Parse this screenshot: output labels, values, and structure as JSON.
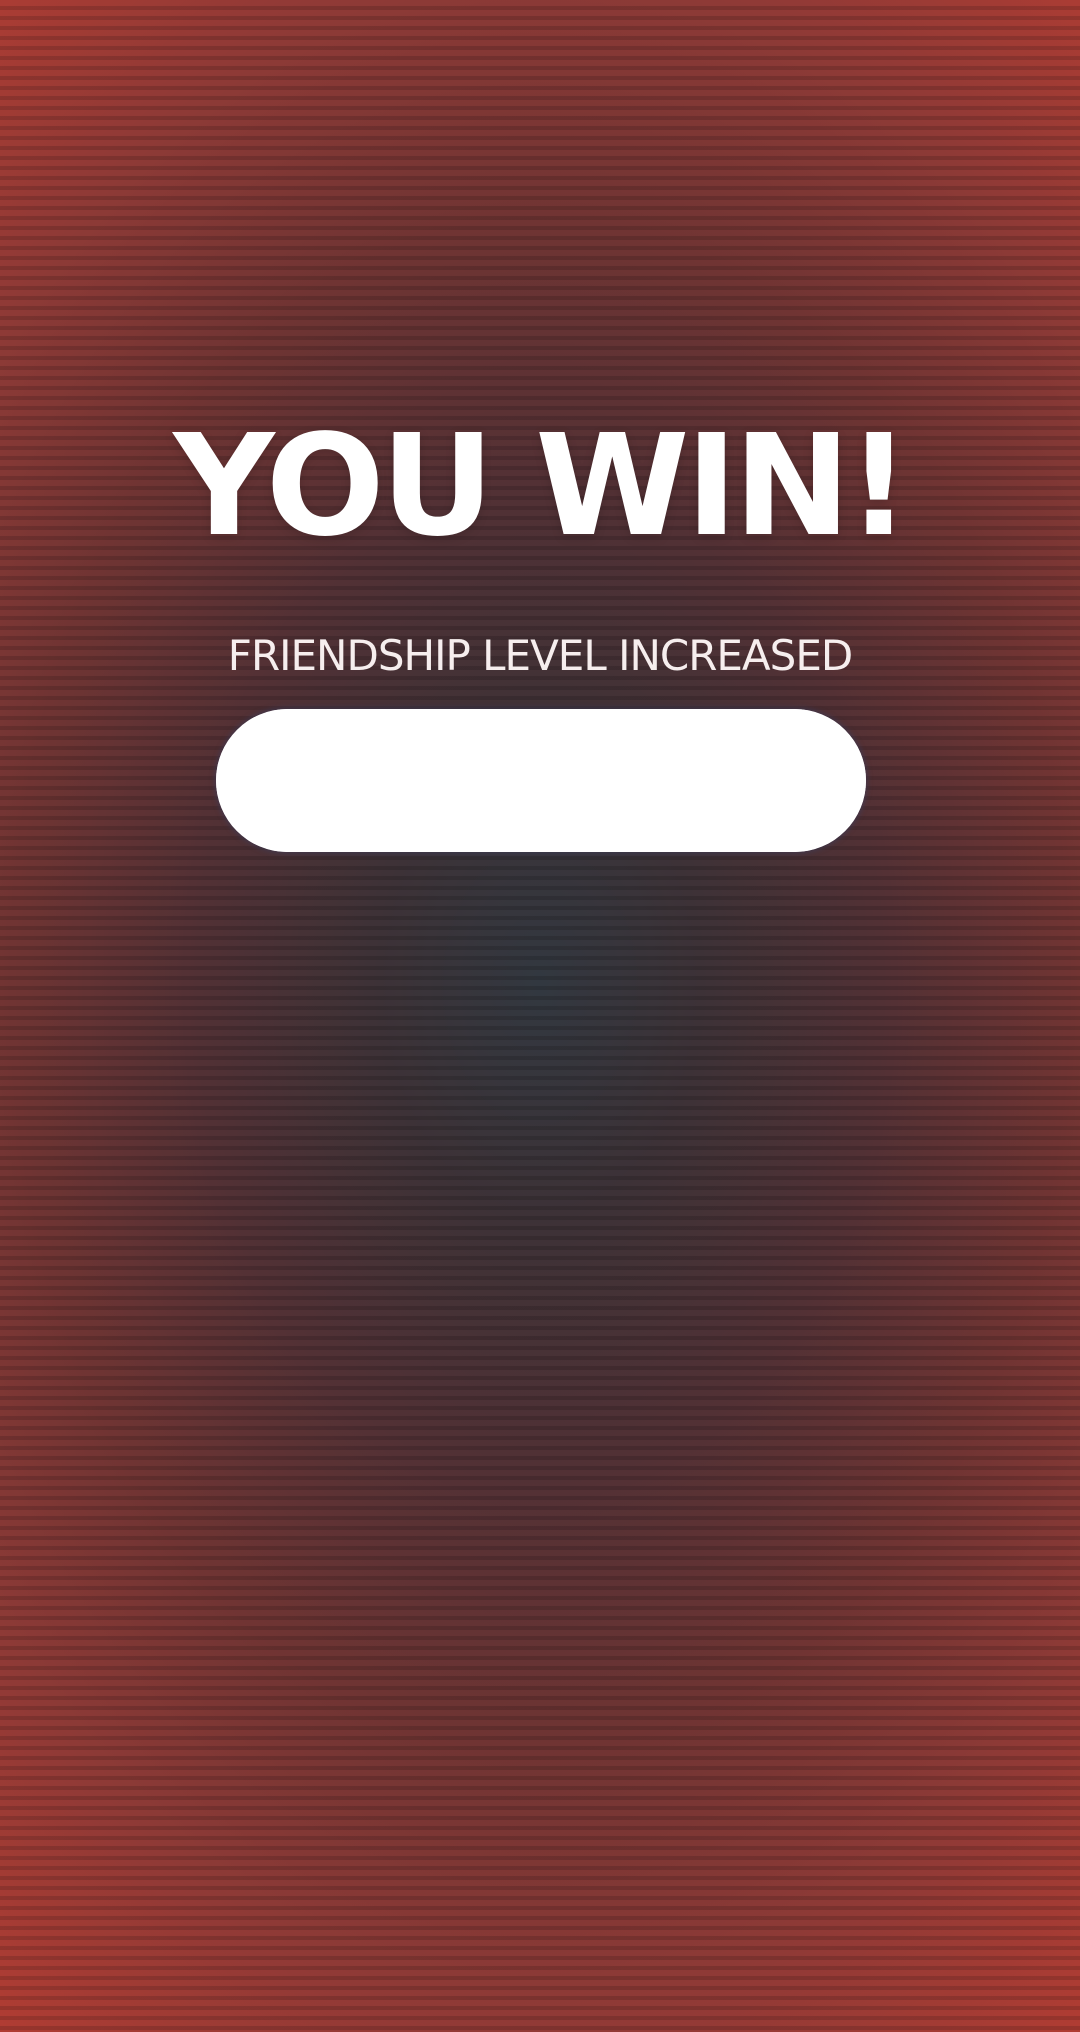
{
  "result": {
    "title": "YOU WIN!",
    "message": "FRIENDSHIP LEVEL INCREASED"
  },
  "friendship_bar": {
    "fill_fraction": 1.0,
    "fill_color": "#ffffff"
  },
  "colors": {
    "center": "#323840",
    "edge": "#b03c33",
    "text": "#ffffff"
  }
}
